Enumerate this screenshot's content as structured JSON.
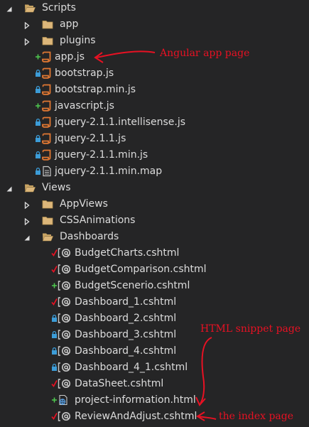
{
  "tree": {
    "items": [
      {
        "label": "Scripts",
        "type": "folder",
        "expanded": true,
        "status": "",
        "level": 0
      },
      {
        "label": "app",
        "type": "folder",
        "expanded": false,
        "status": "",
        "level": 1
      },
      {
        "label": "plugins",
        "type": "folder",
        "expanded": false,
        "status": "",
        "level": 1
      },
      {
        "label": "app.js",
        "type": "js",
        "status": "added",
        "level": 1
      },
      {
        "label": "bootstrap.js",
        "type": "js",
        "status": "locked",
        "level": 1
      },
      {
        "label": "bootstrap.min.js",
        "type": "js",
        "status": "locked",
        "level": 1
      },
      {
        "label": "javascript.js",
        "type": "js",
        "status": "added",
        "level": 1
      },
      {
        "label": "jquery-2.1.1.intellisense.js",
        "type": "js",
        "status": "locked",
        "level": 1
      },
      {
        "label": "jquery-2.1.1.js",
        "type": "js",
        "status": "locked",
        "level": 1
      },
      {
        "label": "jquery-2.1.1.min.js",
        "type": "js",
        "status": "locked",
        "level": 1
      },
      {
        "label": "jquery-2.1.1.min.map",
        "type": "map",
        "status": "locked",
        "level": 1
      },
      {
        "label": "Views",
        "type": "folder",
        "expanded": true,
        "status": "",
        "level": 0
      },
      {
        "label": "AppViews",
        "type": "folder",
        "expanded": false,
        "status": "",
        "level": 1
      },
      {
        "label": "CSSAnimations",
        "type": "folder",
        "expanded": false,
        "status": "",
        "level": 1
      },
      {
        "label": "Dashboards",
        "type": "folder",
        "expanded": true,
        "status": "",
        "level": 1
      },
      {
        "label": "BudgetCharts.cshtml",
        "type": "cshtml",
        "status": "checked",
        "level": 2
      },
      {
        "label": "BudgetComparison.cshtml",
        "type": "cshtml",
        "status": "checked",
        "level": 2
      },
      {
        "label": "BudgetScenerio.cshtml",
        "type": "cshtml",
        "status": "added",
        "level": 2
      },
      {
        "label": "Dashboard_1.cshtml",
        "type": "cshtml",
        "status": "checked",
        "level": 2
      },
      {
        "label": "Dashboard_2.cshtml",
        "type": "cshtml",
        "status": "locked",
        "level": 2
      },
      {
        "label": "Dashboard_3.cshtml",
        "type": "cshtml",
        "status": "locked",
        "level": 2
      },
      {
        "label": "Dashboard_4.cshtml",
        "type": "cshtml",
        "status": "locked",
        "level": 2
      },
      {
        "label": "Dashboard_4_1.cshtml",
        "type": "cshtml",
        "status": "locked",
        "level": 2
      },
      {
        "label": "DataSheet.cshtml",
        "type": "cshtml",
        "status": "checked",
        "level": 2
      },
      {
        "label": "project-information.html",
        "type": "html",
        "status": "added",
        "level": 2
      },
      {
        "label": "ReviewAndAdjust.cshtml",
        "type": "cshtml",
        "status": "checked",
        "level": 2
      }
    ]
  },
  "annotations": {
    "angular": "Angular app page",
    "snippet": "HTML snippet page",
    "index": "the index page",
    "color": "#e81123"
  },
  "colors": {
    "background": "#252526",
    "text": "#dcdcdc",
    "folder": "#dcb67a",
    "js": "#e37933",
    "added": "#4ec94e",
    "checked": "#e81123",
    "locked": "#3c9cd7"
  }
}
